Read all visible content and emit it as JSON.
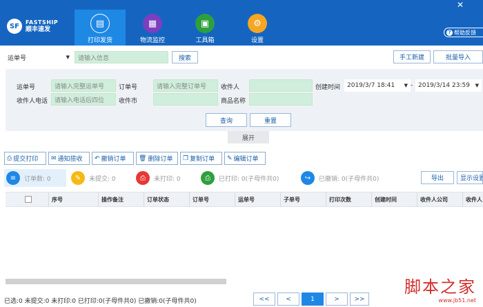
{
  "brand": {
    "logo_mark": "SF",
    "name_en": "FASTSHIP",
    "name_cn": "顺丰速发"
  },
  "nav": [
    {
      "label": "打印发货",
      "icon": "printer-icon",
      "glyph": "▤",
      "color": "#1e88e5"
    },
    {
      "label": "物流监控",
      "icon": "monitor-icon",
      "glyph": "▦",
      "color": "#7b3fbf"
    },
    {
      "label": "工具箱",
      "icon": "toolbox-icon",
      "glyph": "▣",
      "color": "#2e9f3e"
    },
    {
      "label": "设置",
      "icon": "gear-icon",
      "glyph": "⚙",
      "color": "#f5a623"
    }
  ],
  "window": {
    "close": "✕"
  },
  "help": {
    "label": "帮助反馈",
    "glyph": "?"
  },
  "search": {
    "type_value": "运单号",
    "placeholder": "请输入信息",
    "search_label": "搜索",
    "manual_new_label": "手工新建",
    "bulk_import_label": "批量导入"
  },
  "filters": {
    "waybill_label": "运单号",
    "waybill_placeholder": "请输入完整运单号",
    "order_label": "订单号",
    "order_placeholder": "请输入完整订单号",
    "recipient_label": "收件人",
    "created_label": "创建时间",
    "date_from": "2019/3/7 18:41",
    "date_sep": "-",
    "date_to": "2019/3/14 23:59",
    "phone_label": "收件人电话",
    "phone_placeholder": "请输入电话后四位",
    "city_label": "收件市",
    "product_label": "商品名称",
    "query_label": "查询",
    "reset_label": "重置",
    "expand_label": "展开"
  },
  "actions": [
    {
      "label": "提交打印",
      "glyph": "⎙"
    },
    {
      "label": "通知揽收",
      "glyph": "✉"
    },
    {
      "label": "撤销订单",
      "glyph": "↶"
    },
    {
      "label": "删除订单",
      "glyph": "🗑"
    },
    {
      "label": "复制订单",
      "glyph": "❐"
    },
    {
      "label": "编辑订单",
      "glyph": "✎"
    }
  ],
  "stats": [
    {
      "text": "订单数: 0",
      "glyph": "≡",
      "color": "#1e88e5"
    },
    {
      "text": "未提交: 0",
      "glyph": "✎",
      "color": "#f5b915"
    },
    {
      "text": "未打印: 0",
      "glyph": "⎙",
      "color": "#e53935"
    },
    {
      "text": "已打印: 0(子母件共0)",
      "glyph": "⎙",
      "color": "#2e9f3e"
    },
    {
      "text": "已撤销: 0(子母件共0)",
      "glyph": "↪",
      "color": "#1e88e5"
    }
  ],
  "stat_buttons": {
    "export_label": "导出",
    "display_label": "显示设置"
  },
  "table": {
    "columns": [
      "序号",
      "操作备注",
      "订单状态",
      "订单号",
      "运单号",
      "子单号",
      "打印次数",
      "创建时间",
      "收件人公司",
      "收件人"
    ]
  },
  "footer": {
    "summary": "已选:0  未提交:0  未打印:0  已打印:0(子母件共0)  已撤销:0(子母件共0)",
    "first": "<<",
    "prev": "<",
    "current": "1",
    "next": ">",
    "last": ">>"
  },
  "watermark": {
    "big": "脚本之家",
    "small": "www.jb51.net"
  }
}
